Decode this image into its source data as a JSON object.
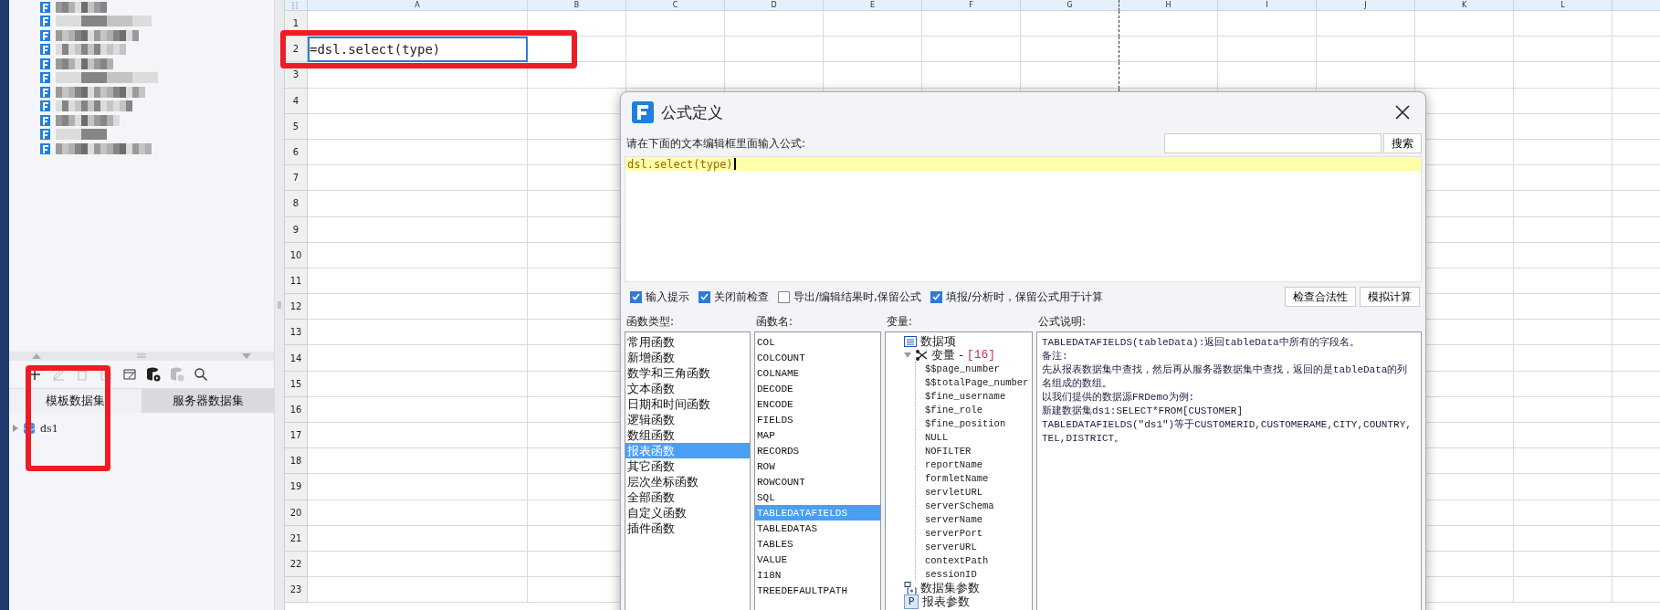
{
  "dataset_panel": {
    "tabs": [
      {
        "label": "模板数据集",
        "selected": true
      },
      {
        "label": "服务器数据集",
        "selected": false
      }
    ],
    "tree": [
      {
        "label": "ds1",
        "expanded": false
      }
    ]
  },
  "sheet": {
    "columns": [
      "A",
      "B",
      "C",
      "D",
      "E",
      "F",
      "G",
      "H",
      "I",
      "J",
      "K",
      "L"
    ],
    "rows": [
      {
        "label": "1"
      },
      {
        "label": "2",
        "cell_a": {
          "text": "=dsl.select(type)",
          "selected": true
        }
      },
      {
        "label": "3"
      },
      {
        "label": "4"
      },
      {
        "label": "5"
      },
      {
        "label": "6"
      },
      {
        "label": "7"
      },
      {
        "label": "8"
      },
      {
        "label": "9"
      },
      {
        "label": "10"
      },
      {
        "label": "11"
      },
      {
        "label": "12"
      },
      {
        "label": "13"
      },
      {
        "label": "14"
      },
      {
        "label": "15"
      },
      {
        "label": "16"
      },
      {
        "label": "17"
      },
      {
        "label": "18"
      },
      {
        "label": "19"
      },
      {
        "label": "20"
      },
      {
        "label": "21"
      },
      {
        "label": "22"
      },
      {
        "label": "23"
      }
    ]
  },
  "dialog": {
    "title": "公式定义",
    "prompt": "请在下面的文本编辑框里面输入公式:",
    "search": {
      "button": "搜索"
    },
    "editor": {
      "value": "dsl.select(type)"
    },
    "options": [
      {
        "label": "输入提示",
        "checked": true
      },
      {
        "label": "关闭前检查",
        "checked": true
      },
      {
        "label": "导出/编辑结果时,保留公式",
        "checked": false
      },
      {
        "label": "填报/分析时，保留公式用于计算",
        "checked": true
      }
    ],
    "buttons": [
      "检查合法性",
      "模拟计算"
    ],
    "function_types": {
      "header": "函数类型:",
      "items": [
        {
          "label": "常用函数",
          "selected": false
        },
        {
          "label": "新增函数",
          "selected": false
        },
        {
          "label": "数学和三角函数",
          "selected": false
        },
        {
          "label": "文本函数",
          "selected": false
        },
        {
          "label": "日期和时间函数",
          "selected": false
        },
        {
          "label": "逻辑函数",
          "selected": false
        },
        {
          "label": "数组函数",
          "selected": false
        },
        {
          "label": "报表函数",
          "selected": true
        },
        {
          "label": "其它函数",
          "selected": false
        },
        {
          "label": "层次坐标函数",
          "selected": false
        },
        {
          "label": "全部函数",
          "selected": false
        },
        {
          "label": "自定义函数",
          "selected": false
        },
        {
          "label": "插件函数",
          "selected": false
        }
      ]
    },
    "function_names": {
      "header": "函数名:",
      "items": [
        {
          "label": "COL",
          "selected": false
        },
        {
          "label": "COLCOUNT",
          "selected": false
        },
        {
          "label": "COLNAME",
          "selected": false
        },
        {
          "label": "DECODE",
          "selected": false
        },
        {
          "label": "ENCODE",
          "selected": false
        },
        {
          "label": "FIELDS",
          "selected": false
        },
        {
          "label": "MAP",
          "selected": false
        },
        {
          "label": "RECORDS",
          "selected": false
        },
        {
          "label": "ROW",
          "selected": false
        },
        {
          "label": "ROWCOUNT",
          "selected": false
        },
        {
          "label": "SQL",
          "selected": false
        },
        {
          "label": "TABLEDATAFIELDS",
          "selected": true
        },
        {
          "label": "TABLEDATAS",
          "selected": false
        },
        {
          "label": "TABLES",
          "selected": false
        },
        {
          "label": "VALUE",
          "selected": false
        },
        {
          "label": "I18N",
          "selected": false
        },
        {
          "label": "TREEDEFAULTPATH",
          "selected": false
        }
      ]
    },
    "variables": {
      "header": "变量:",
      "items": [
        {
          "kind": "data-item",
          "label": "数据项"
        },
        {
          "kind": "variables",
          "label": "变量 -",
          "count": "[16]",
          "expanded": true,
          "children": [
            {
              "label": "$$page_number"
            },
            {
              "label": "$$totalPage_number"
            },
            {
              "label": "$fine_username"
            },
            {
              "label": "$fine_role"
            },
            {
              "label": "$fine_position"
            },
            {
              "label": "NULL"
            },
            {
              "label": "NOFILTER"
            },
            {
              "label": "reportName"
            },
            {
              "label": "formletName"
            },
            {
              "label": "servletURL"
            },
            {
              "label": "serverSchema"
            },
            {
              "label": "serverName"
            },
            {
              "label": "serverPort"
            },
            {
              "label": "serverURL"
            },
            {
              "label": "contextPath"
            },
            {
              "label": "sessionID"
            }
          ]
        },
        {
          "kind": "dataset-params",
          "label": "数据集参数"
        },
        {
          "kind": "report-params",
          "label": "报表参数",
          "badge": "P"
        }
      ]
    },
    "description": {
      "header": "公式说明:",
      "paragraphs": [
        "TABLEDATAFIELDS(tableData):返回tableData中所有的字段名。",
        "备注:",
        "先从报表数据集中查找，然后再从服务器数据集中查找，返回的是tableData的列名组成的数组。",
        "以我们提供的数据源FRDemo为例:",
        "新建数据集ds1:SELECT*FROM[CUSTOMER]",
        "TABLEDATAFIELDS(\"ds1\")等于CUSTOMERID,CUSTOMERAME,CITY,COUNTRY,TEL,DISTRICT。"
      ]
    }
  }
}
